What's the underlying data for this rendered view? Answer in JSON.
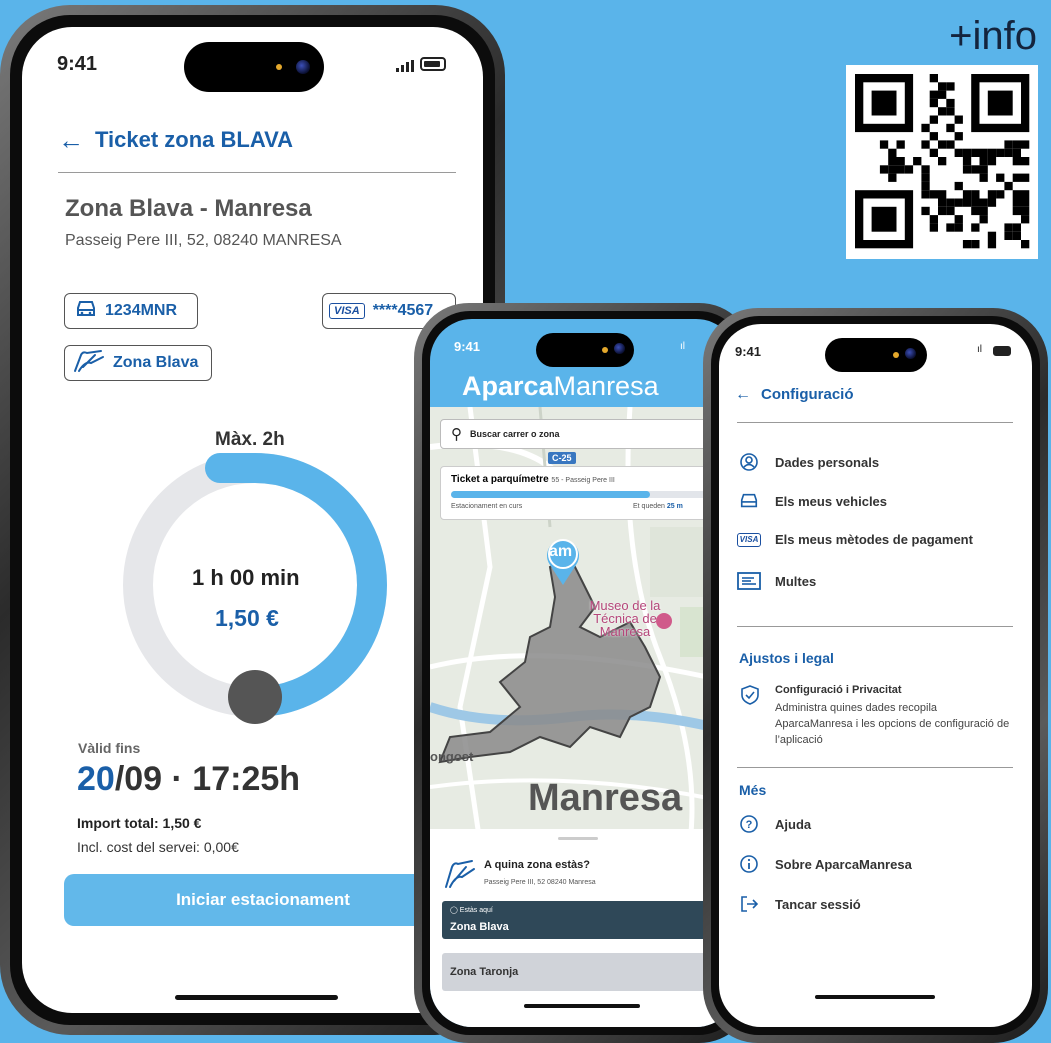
{
  "info_label": "+info",
  "phone1": {
    "status_time": "9:41",
    "back_title": "Ticket zona BLAVA",
    "zone_name": "Zona Blava - Manresa",
    "address": "Passeig Pere III, 52, 08240 MANRESA",
    "plate": "1234MNR",
    "card_brand": "VISA",
    "card_number": "****4567",
    "zone_chip": "Zona Blava",
    "max_label": "Màx. 2h",
    "elapsed": "1 h 00 min",
    "price": "1,50 €",
    "progress_fraction": 0.5,
    "valid_label": "Vàlid fins",
    "valid_day": "20",
    "valid_rest": "/09 · 17:25h",
    "total": "Import total: 1,50 €",
    "service_cost": "Incl. cost del servei: 0,00€",
    "start_button": "Iniciar estacionament"
  },
  "phone2": {
    "status_time": "9:41",
    "brand_bold": "Aparca",
    "brand_light": "Manresa",
    "search_placeholder": "Buscar carrer o zona",
    "road_badge": "C-25",
    "ticket_title": "Ticket a parquímetre",
    "ticket_sub": "55 - Passeig Pere III",
    "ticket_status": "Estacionament en curs",
    "ticket_remaining_prefix": "Et queden",
    "ticket_remaining": "25 m",
    "ticket_progress": 0.78,
    "pin_label": "am",
    "poi_name": "Museo de la Técnica de Manresa",
    "map_label_left": "ongost",
    "map_city": "Manresa",
    "zone_question": "A quina zona estàs?",
    "zone_address": "Passeig Pere III, 52 08240 Manresa",
    "you_are_here": "Estàs aquí",
    "zone_active": "Zona Blava",
    "zone_other": "Zona Taronja"
  },
  "phone3": {
    "status_time": "9:41",
    "title": "Configuració",
    "items": [
      {
        "icon": "user-icon",
        "label": "Dades personals"
      },
      {
        "icon": "car-icon",
        "label": "Els meus vehicles"
      },
      {
        "icon": "visa-icon",
        "label": "Els meus mètodes de pagament"
      },
      {
        "icon": "ticket-icon",
        "label": "Multes"
      }
    ],
    "section_legal": "Ajustos i legal",
    "privacy_title": "Configuració i Privacitat",
    "privacy_desc": "Administra quines dades recopila AparcaManresa i les opcions de configuració de l’aplicació",
    "section_more": "Més",
    "more_items": [
      {
        "icon": "help-icon",
        "label": "Ajuda"
      },
      {
        "icon": "info-icon",
        "label": "Sobre AparcaManresa"
      },
      {
        "icon": "logout-icon",
        "label": "Tancar sessió"
      }
    ]
  },
  "colors": {
    "background": "#5ab4ea",
    "brand_blue": "#1a5fa8",
    "progress_blue": "#5ab4ea",
    "ring_gray": "#e6e7ea",
    "button_blue": "#62b8ea",
    "dark_zone": "#2f4858"
  }
}
